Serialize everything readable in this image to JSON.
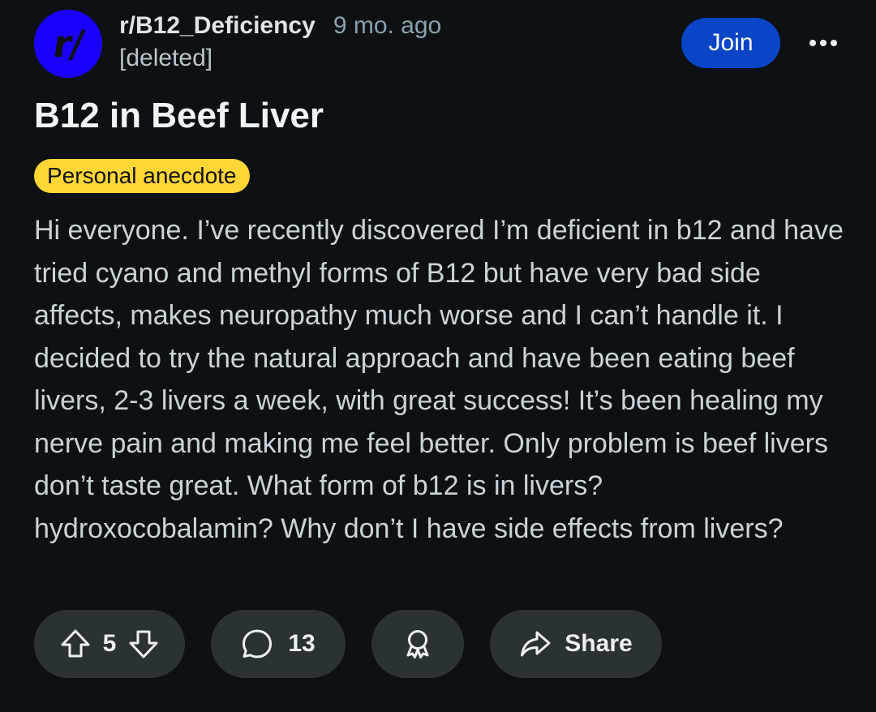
{
  "header": {
    "avatar_text": "r/",
    "subreddit": "r/B12_Deficiency",
    "time_ago": "9 mo. ago",
    "author": "[deleted]",
    "join_label": "Join",
    "more_icon": "more-horizontal-icon",
    "avatar_color": "#1a00ff",
    "join_color": "#0a45c7"
  },
  "post": {
    "title": "B12 in Beef Liver",
    "flair": "Personal anecdote",
    "flair_color": "#ffd635",
    "body": "Hi everyone. I’ve recently discovered I’m deficient in b12 and have tried cyano and methyl forms of B12 but have very bad side affects, makes neuropathy much worse and I can’t handle it. I decided to try the natural approach and have been eating beef livers, 2-3 livers a week, with great success! It’s been healing my nerve pain and making me feel better. Only problem is beef livers don’t taste great. What form of b12 is in livers? hydroxocobalamin? Why don’t I have side effects from livers?"
  },
  "actions": {
    "upvote_icon": "upvote-arrow-icon",
    "vote_count": "5",
    "downvote_icon": "downvote-arrow-icon",
    "comment_icon": "comment-bubble-icon",
    "comment_count": "13",
    "award_icon": "award-ribbon-icon",
    "share_icon": "share-arrow-icon",
    "share_label": "Share"
  }
}
